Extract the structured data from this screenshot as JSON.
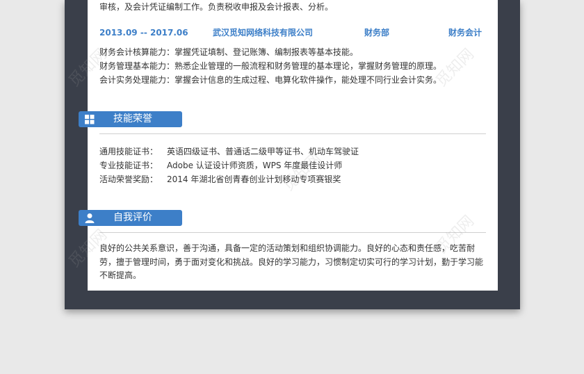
{
  "work": {
    "prev_line": "审核，及会计凭证编制工作。负责税收申报及会计报表、分析。",
    "entry": {
      "date": "2013.09 -- 2017.06",
      "company": "武汉觅知网络科技有限公司",
      "department": "财务部",
      "position": "财务会计"
    },
    "lines": [
      "财务会计核算能力：掌握凭证填制、登记账簿、编制报表等基本技能。",
      "财务管理基本能力：熟悉企业管理的一般流程和财务管理的基本理论，掌握财务管理的原理。",
      "会计实务处理能力：掌握会计信息的生成过程、电算化软件操作，能处理不同行业会计实务。"
    ]
  },
  "skills": {
    "title": "技能荣誉",
    "icon": "windows-icon",
    "rows": [
      {
        "label": "通用技能证书：",
        "value": "英语四级证书、普通话二级甲等证书、机动车驾驶证"
      },
      {
        "label": "专业技能证书：",
        "value": "Adobe 认证设计师资质，WPS 年度最佳设计师"
      },
      {
        "label": "活动荣誉奖励：",
        "value": "2014 年湖北省创青春创业计划移动专项赛银奖"
      }
    ]
  },
  "self_eval": {
    "title": "自我评价",
    "icon": "user-icon",
    "text": "良好的公共关系意识，善于沟通，具备一定的活动策划和组织协调能力。良好的心态和责任感，吃苦耐劳，擅于管理时间，勇于面对变化和挑战。良好的学习能力，习惯制定切实可行的学习计划，勤于学习能不断提高。"
  },
  "watermark": "觅知网",
  "colors": {
    "accent": "#3d7fc8",
    "frame": "#3a3f4a",
    "page": "#ffffff"
  }
}
